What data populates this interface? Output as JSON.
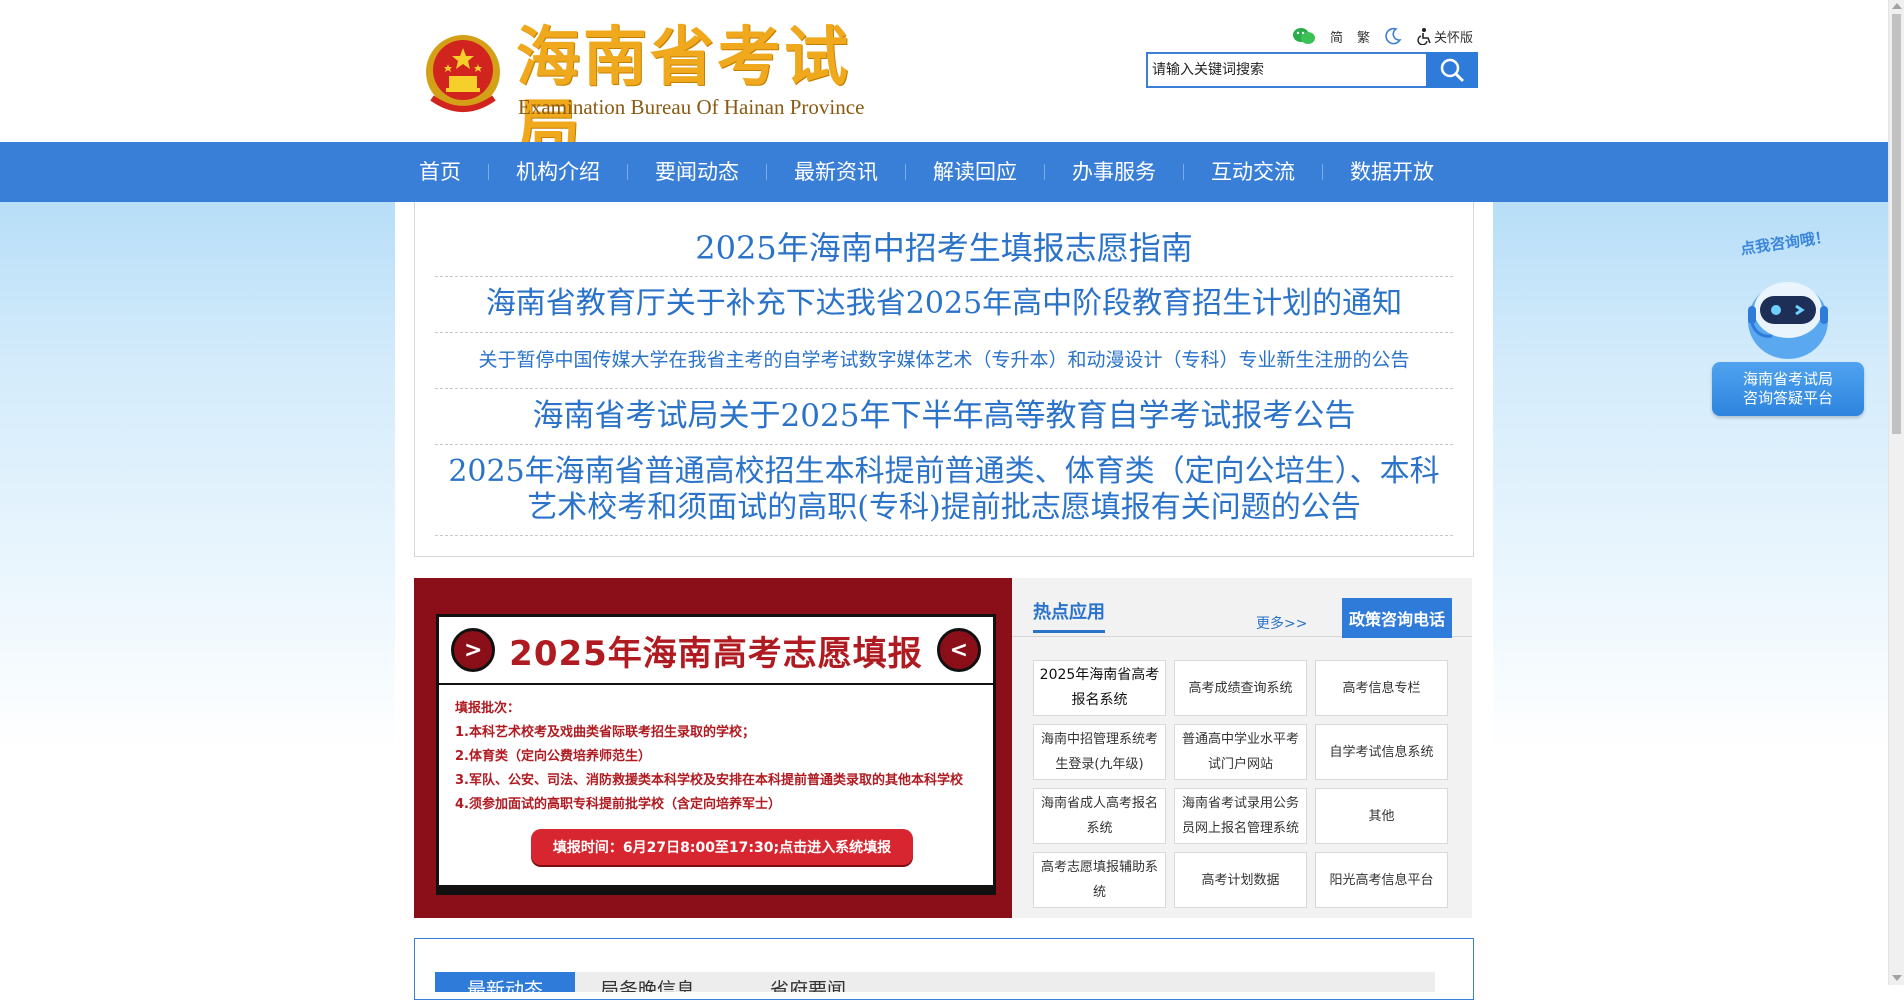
{
  "header": {
    "logo_cn": "海南省考试局",
    "logo_en": "Examination Bureau Of Hainan Province",
    "tools": {
      "simplified": "简",
      "traditional": "繁",
      "care_mode": "关怀版"
    },
    "search": {
      "placeholder": "请输入关键词搜索"
    }
  },
  "nav": {
    "items": [
      "首页",
      "机构介绍",
      "要闻动态",
      "最新资讯",
      "解读回应",
      "办事服务",
      "互动交流",
      "数据开放"
    ]
  },
  "headlines": [
    "2025年海南中招考生填报志愿指南",
    "海南省教育厅关于补充下达我省2025年高中阶段教育招生计划的通知",
    "关于暂停中国传媒大学在我省主考的自学考试数字媒体艺术（专升本）和动漫设计（专科）专业新生注册的公告",
    "海南省考试局关于2025年下半年高等教育自学考试报考公告",
    "2025年海南省普通高校招生本科提前普通类、体育类（定向公培生）、本科艺术校考和须面试的高职(专科)提前批志愿填报有关问题的公告"
  ],
  "banner": {
    "arrow_left": ">",
    "arrow_right": "<",
    "title": "2025年海南高考志愿填报",
    "lines": [
      "填报批次：",
      "1.本科艺术校考及戏曲类省际联考招生录取的学校；",
      "2.体育类（定向公费培养师范生）",
      "3.军队、公安、司法、消防救援类本科学校及安排在本科提前普通类录取的其他本科学校",
      "4.须参加面试的高职专科提前批学校（含定向培养军士）"
    ],
    "button": "填报时间：6月27日8:00至17:30;点击进入系统填报"
  },
  "hot": {
    "title": "热点应用",
    "more": "更多>>",
    "phone": "政策咨询电话",
    "apps": [
      "2025年海南省高考报名系统",
      "高考成绩查询系统",
      "高考信息专栏",
      "海南中招管理系统考生登录(九年级)",
      "普通高中学业水平考试门户网站",
      "自学考试信息系统",
      "海南省成人高考报名系统",
      "海南省考试录用公务员网上报名管理系统",
      "其他",
      "高考志愿填报辅助系统",
      "高考计划数据",
      "阳光高考信息平台"
    ]
  },
  "tabs": {
    "items": [
      "最新动态",
      "局务晚信息",
      "省府要闻"
    ]
  },
  "float_widget": {
    "top_text": "点我咨询哦！",
    "card_line1": "海南省考试局",
    "card_line2": "咨询答疑平台"
  },
  "colors": {
    "nav_blue": "#3a7fd7",
    "headline_blue": "#2a73c9",
    "logo_gold": "#f0a81c",
    "banner_red": "#8b0f19"
  }
}
